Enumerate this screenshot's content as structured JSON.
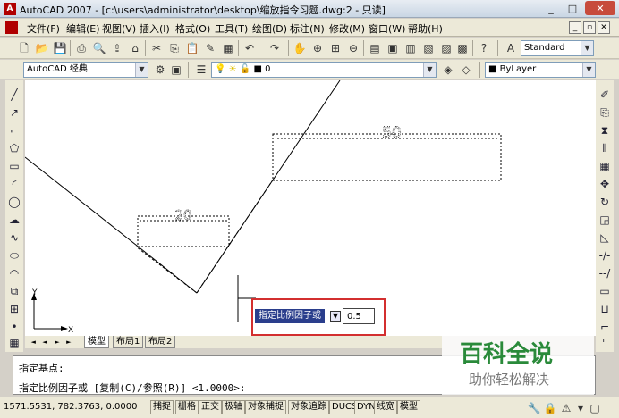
{
  "window": {
    "icon_text": "A",
    "title": "AutoCAD 2007 - [c:\\users\\administrator\\desktop\\缩放指令习题.dwg:2 - 只读]",
    "minimize": "_",
    "maximize": "□",
    "close": "✕"
  },
  "menu": {
    "items": [
      "文件(F)",
      "编辑(E)",
      "视图(V)",
      "插入(I)",
      "格式(O)",
      "工具(T)",
      "绘图(D)",
      "标注(N)",
      "修改(M)",
      "窗口(W)",
      "帮助(H)"
    ],
    "mdi_min": "_",
    "mdi_restore": "▫",
    "mdi_close": "✕"
  },
  "toolbar_top": {
    "text_style": "Standard"
  },
  "toolbar_second": {
    "workspace": "AutoCAD 经典",
    "layer": "0",
    "color": "■ ByLayer"
  },
  "drawing": {
    "dim_large": "50",
    "dim_small": "20",
    "axis_y": "Y",
    "axis_x": "X"
  },
  "dynamic_input": {
    "prompt": "指定比例因子或",
    "down_arrow": "▼",
    "value": "0.5"
  },
  "layout_tabs": {
    "nav": [
      "|◄",
      "◄",
      "►",
      "►|"
    ],
    "tabs": [
      "模型",
      "布局1",
      "布局2"
    ]
  },
  "command": {
    "line1": "指定基点:",
    "line2": "指定比例因子或 [复制(C)/参照(R)] <1.0000>:"
  },
  "status": {
    "coords": "1571.5531, 782.3763, 0.0000",
    "buttons": [
      "捕捉",
      "栅格",
      "正交",
      "极轴",
      "对象捕捉",
      "对象追踪",
      "DUCS",
      "DYN",
      "线宽",
      "模型"
    ]
  },
  "watermark": {
    "logo": "百科全说",
    "subtitle": "助你轻松解决"
  },
  "colors": {
    "dialog_border": "#d32f2f",
    "prompt_bg": "#2a3e8c",
    "watermark_green": "#2a8a3a"
  }
}
